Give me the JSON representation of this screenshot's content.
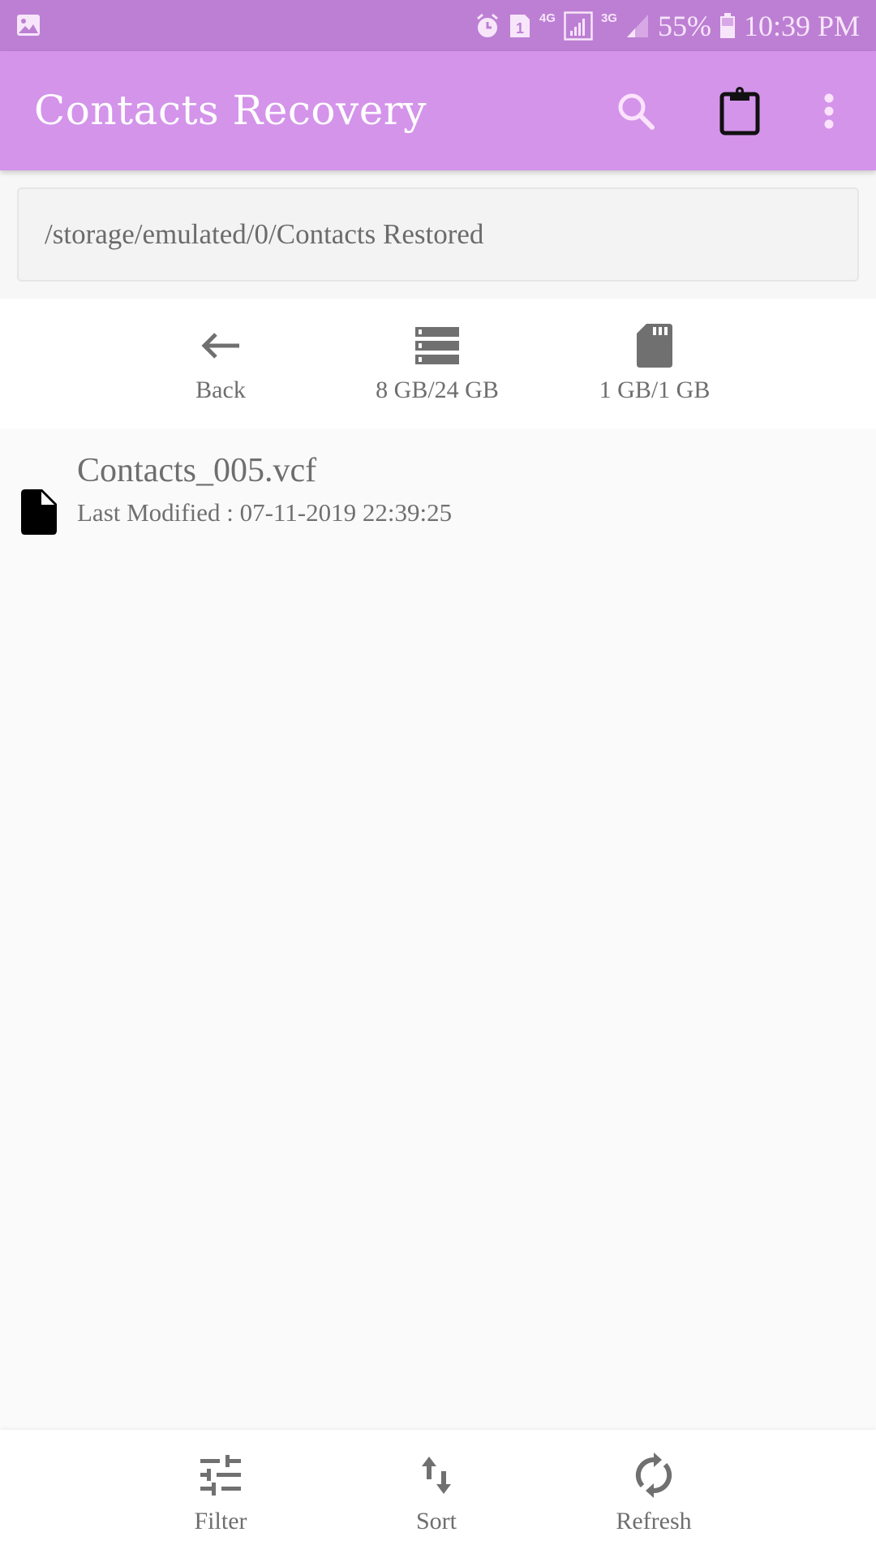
{
  "status_bar": {
    "battery": "55%",
    "time": "10:39 PM",
    "network_1": "4G",
    "network_2": "3G",
    "sim_slot": "1",
    "icons": [
      "gallery-icon",
      "alarm-icon",
      "sim-icon",
      "signal-icon",
      "battery-icon"
    ]
  },
  "app_bar": {
    "title": "Contacts Recovery",
    "actions": [
      "search",
      "clipboard",
      "more-options"
    ]
  },
  "path": {
    "value": "/storage/emulated/0/Contacts Restored"
  },
  "storage_bar": {
    "back_label": "Back",
    "internal_label": "8 GB/24 GB",
    "sd_label": "1 GB/1 GB"
  },
  "files": [
    {
      "name": "Contacts_005.vcf",
      "meta": "Last Modified : 07-11-2019 22:39:25"
    }
  ],
  "bottom_bar": {
    "filter_label": "Filter",
    "sort_label": "Sort",
    "refresh_label": "Refresh"
  },
  "colors": {
    "status_bar": "#bd7fd4",
    "app_bar": "#d494ea",
    "icon_gray": "#707070"
  }
}
